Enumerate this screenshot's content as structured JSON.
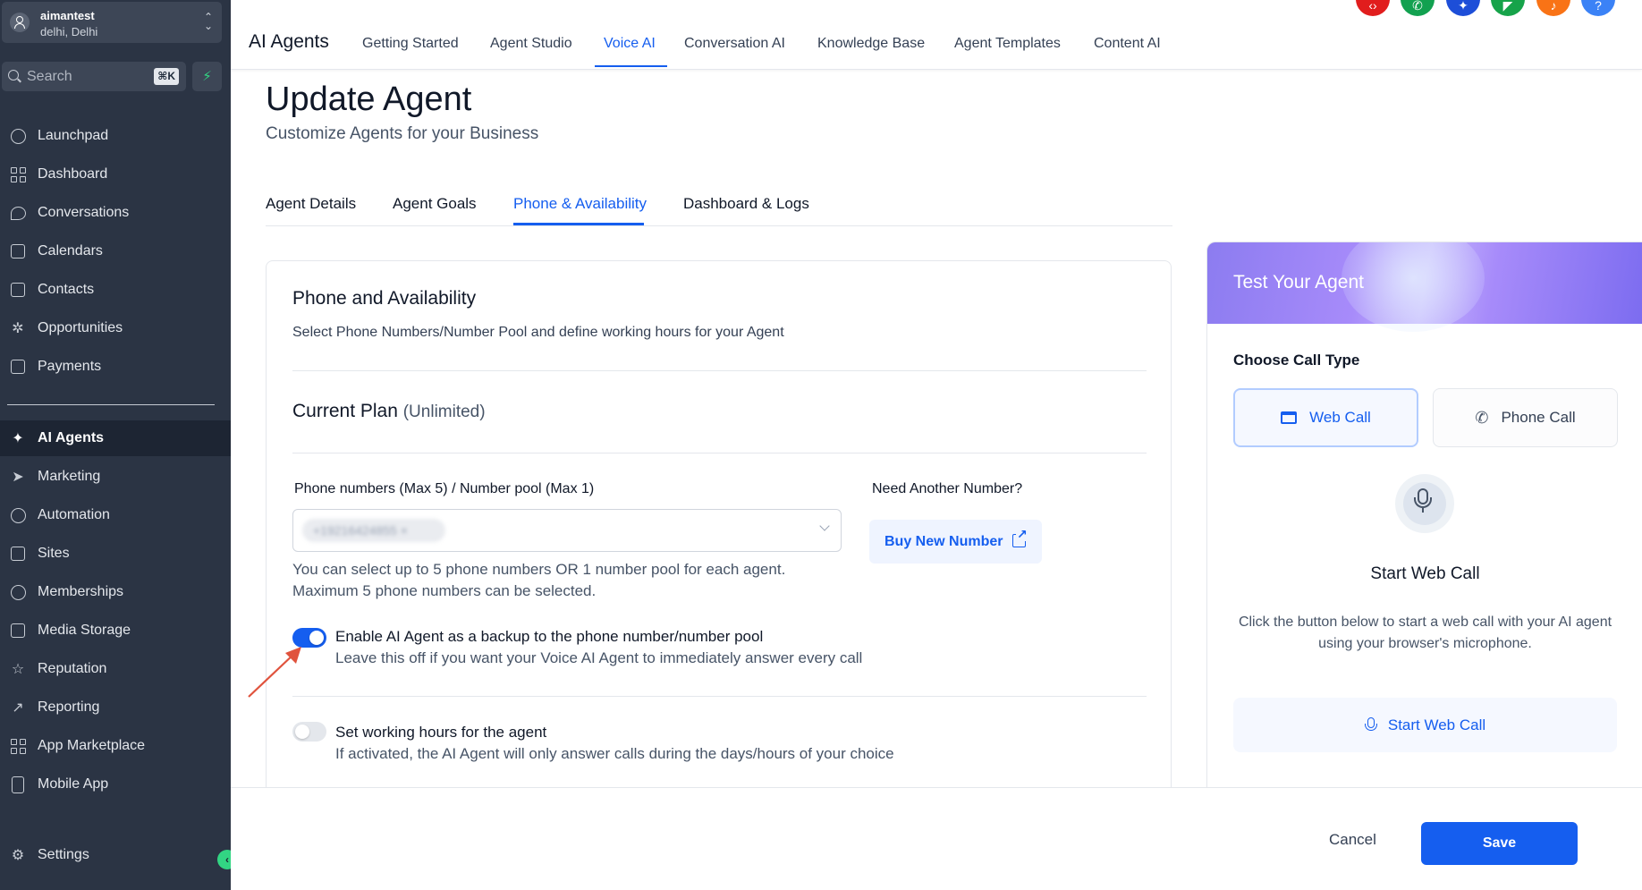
{
  "account": {
    "name": "aimantest",
    "location": "delhi, Delhi"
  },
  "search": {
    "placeholder": "Search",
    "shortcut": "⌘K"
  },
  "sidebar": {
    "items": [
      {
        "label": "Launchpad",
        "icon": "rocket-icon"
      },
      {
        "label": "Dashboard",
        "icon": "dashboard-grid-icon"
      },
      {
        "label": "Conversations",
        "icon": "chat-bubble-icon"
      },
      {
        "label": "Calendars",
        "icon": "calendar-icon"
      },
      {
        "label": "Contacts",
        "icon": "contacts-icon"
      },
      {
        "label": "Opportunities",
        "icon": "opportunities-icon"
      },
      {
        "label": "Payments",
        "icon": "payments-icon"
      },
      {
        "label": "AI Agents",
        "icon": "sparkles-icon",
        "active": true
      },
      {
        "label": "Marketing",
        "icon": "send-icon"
      },
      {
        "label": "Automation",
        "icon": "automation-icon"
      },
      {
        "label": "Sites",
        "icon": "sites-icon"
      },
      {
        "label": "Memberships",
        "icon": "award-icon"
      },
      {
        "label": "Media Storage",
        "icon": "image-icon"
      },
      {
        "label": "Reputation",
        "icon": "star-icon"
      },
      {
        "label": "Reporting",
        "icon": "trending-icon"
      },
      {
        "label": "App Marketplace",
        "icon": "apps-grid-icon"
      },
      {
        "label": "Mobile App",
        "icon": "mobile-icon"
      },
      {
        "label": "Settings",
        "icon": "gear-icon"
      }
    ]
  },
  "topbar": {
    "brand": "AI Agents",
    "tabs": [
      "Getting Started",
      "Agent Studio",
      "Voice AI",
      "Conversation AI",
      "Knowledge Base",
      "Agent Templates",
      "Content AI"
    ],
    "active_tab": "Voice AI",
    "action_colors": [
      "#e11d1d",
      "#12a150",
      "#1d4ed8",
      "#16a34a",
      "#f97316",
      "#3b82f6"
    ]
  },
  "page": {
    "title": "Update Agent",
    "subtitle": "Customize Agents for your Business",
    "tabs": [
      "Agent Details",
      "Agent Goals",
      "Phone & Availability",
      "Dashboard & Logs"
    ],
    "active_tab": "Phone & Availability"
  },
  "phone_section": {
    "title": "Phone and Availability",
    "description": "Select Phone Numbers/Number Pool and define working hours for your Agent",
    "plan_label": "Current Plan",
    "plan_value": "(Unlimited)",
    "numbers_label": "Phone numbers (Max 5) / Number pool (Max 1)",
    "selected_number": "+19216424855 ×",
    "need_label": "Need Another Number?",
    "buy_button": "Buy New Number",
    "help_line1": "You can select up to 5 phone numbers OR 1 number pool for each agent.",
    "help_line2": "Maximum 5 phone numbers can be selected.",
    "backup_toggle": {
      "title": "Enable AI Agent as a backup to the phone number/number pool",
      "description": "Leave this off if you want your Voice AI Agent to immediately answer every call",
      "on": true
    },
    "hours_toggle": {
      "title": "Set working hours for the agent",
      "description": "If activated, the AI Agent will only answer calls during the days/hours of your choice",
      "on": false
    }
  },
  "test_panel": {
    "title": "Test Your Agent",
    "choose_label": "Choose Call Type",
    "web_call": "Web Call",
    "phone_call": "Phone Call",
    "start_title": "Start Web Call",
    "start_description": "Click the button below to start a web call with your AI agent using your browser's microphone.",
    "start_button": "Start Web Call"
  },
  "footer": {
    "cancel": "Cancel",
    "save": "Save"
  },
  "colors": {
    "accent": "#155eef",
    "sidebar_bg": "#2b3444",
    "annotation_arrow": "#e0533d"
  }
}
